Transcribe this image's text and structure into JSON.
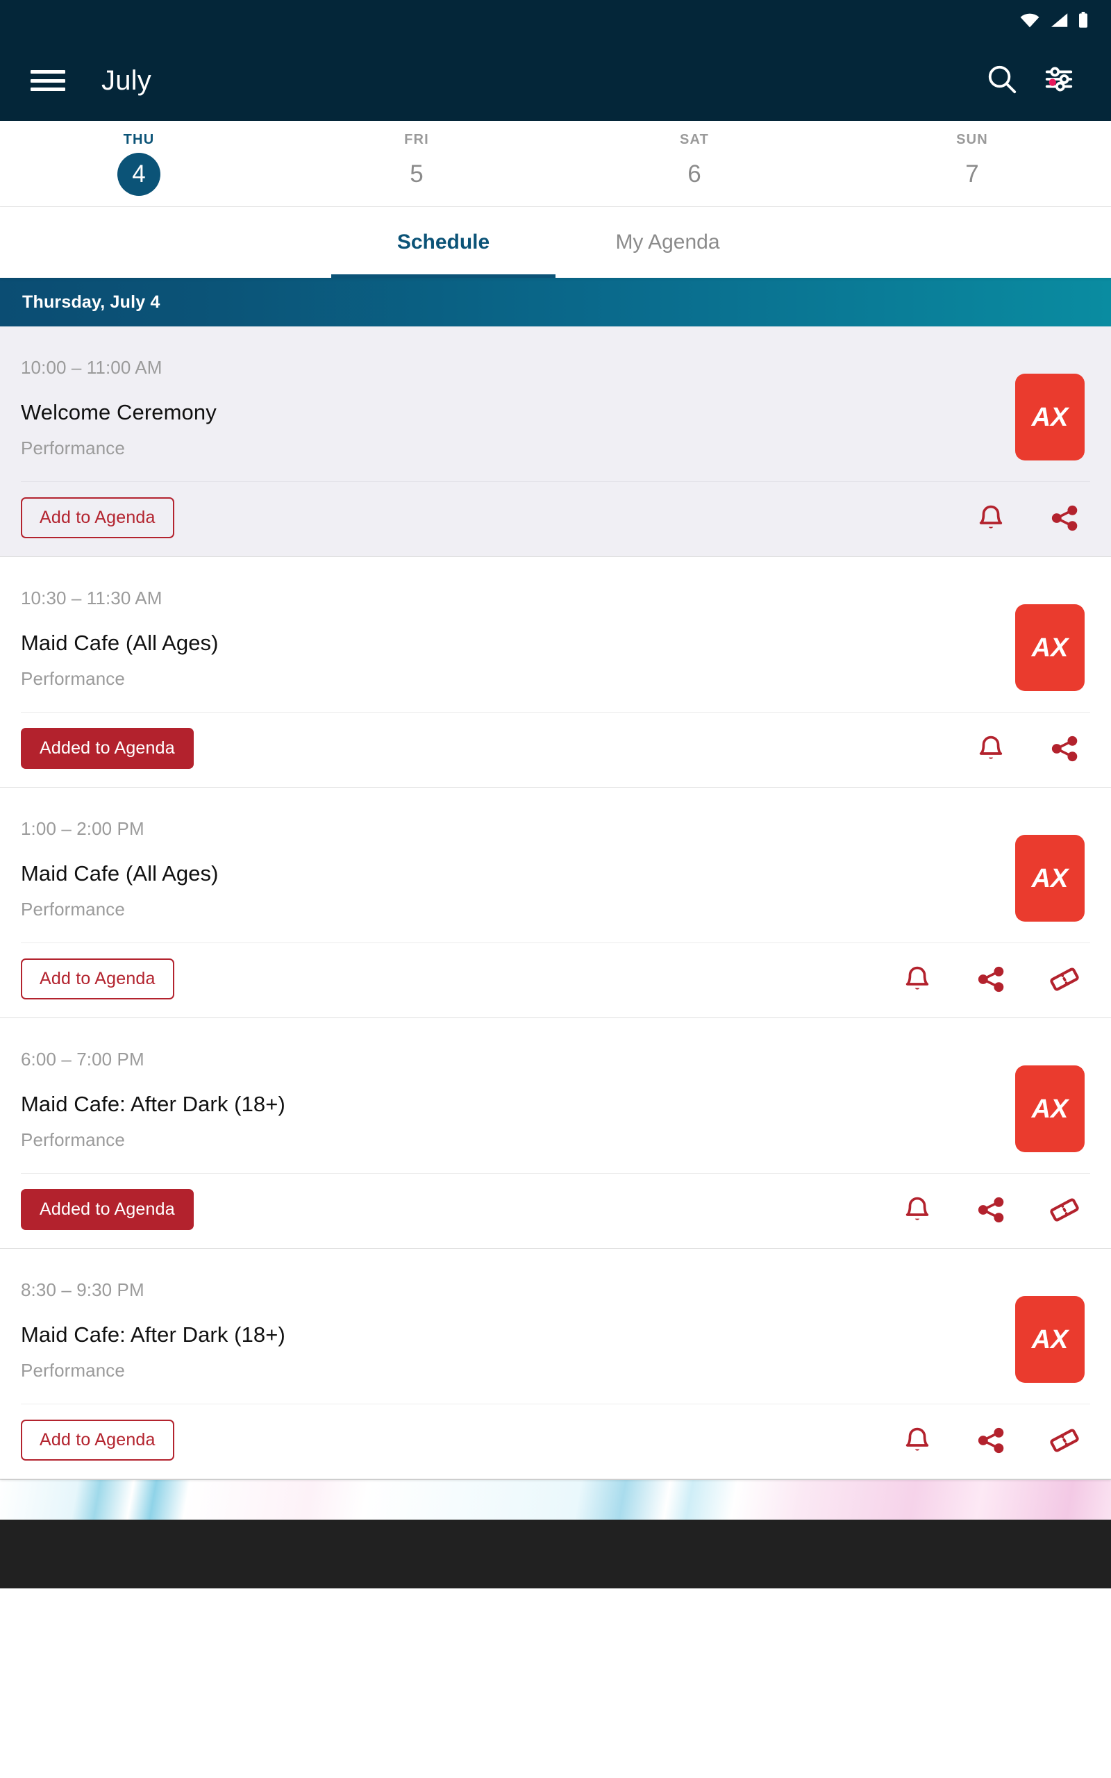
{
  "statusbar": {
    "icons": [
      "wifi-icon",
      "cellular-signal-icon",
      "battery-icon"
    ]
  },
  "appbar": {
    "menu_icon": "hamburger-menu-icon",
    "title": "July",
    "search_icon": "search-icon",
    "filter_icon": "filter-tune-icon",
    "filter_badge_color": "#e8195c",
    "background_color": "#042639"
  },
  "date_strip": {
    "days": [
      {
        "dow": "THU",
        "num": "4",
        "active": true
      },
      {
        "dow": "FRI",
        "num": "5",
        "active": false
      },
      {
        "dow": "SAT",
        "num": "6",
        "active": false
      },
      {
        "dow": "SUN",
        "num": "7",
        "active": false
      }
    ]
  },
  "tabs": [
    {
      "label": "Schedule",
      "active": true
    },
    {
      "label": "My Agenda",
      "active": false
    }
  ],
  "day_header": {
    "label": "Thursday, July 4",
    "gradient_from": "#0b4d73",
    "gradient_to": "#0a8ca1"
  },
  "colors": {
    "accent_navy": "#0b5377",
    "accent_red": "#b3222d",
    "logo_red": "#ea3b2e",
    "muted_text": "#9b9b9b"
  },
  "events": [
    {
      "time": "10:00 – 11:00 AM",
      "title": "Welcome Ceremony",
      "category": "Performance",
      "logo_text": "AX",
      "button_label": "Add to Agenda",
      "button_state": "outline",
      "highlighted": true,
      "icons": [
        "bell-icon",
        "share-icon"
      ]
    },
    {
      "time": "10:30 – 11:30 AM",
      "title": "Maid Cafe (All Ages)",
      "category": "Performance",
      "logo_text": "AX",
      "button_label": "Added to Agenda",
      "button_state": "filled",
      "highlighted": false,
      "icons": [
        "bell-icon",
        "share-icon"
      ]
    },
    {
      "time": "1:00 – 2:00 PM",
      "title": "Maid Cafe (All Ages)",
      "category": "Performance",
      "logo_text": "AX",
      "button_label": "Add to Agenda",
      "button_state": "outline",
      "highlighted": false,
      "icons": [
        "bell-icon",
        "share-icon",
        "ticket-icon"
      ]
    },
    {
      "time": "6:00 – 7:00 PM",
      "title": "Maid Cafe: After Dark (18+)",
      "category": "Performance",
      "logo_text": "AX",
      "button_label": "Added to Agenda",
      "button_state": "filled",
      "highlighted": false,
      "icons": [
        "bell-icon",
        "share-icon",
        "ticket-icon"
      ]
    },
    {
      "time": "8:30 – 9:30 PM",
      "title": "Maid Cafe: After Dark (18+)",
      "category": "Performance",
      "logo_text": "AX",
      "button_label": "Add to Agenda",
      "button_state": "outline",
      "highlighted": false,
      "icons": [
        "bell-icon",
        "share-icon",
        "ticket-icon"
      ]
    }
  ]
}
